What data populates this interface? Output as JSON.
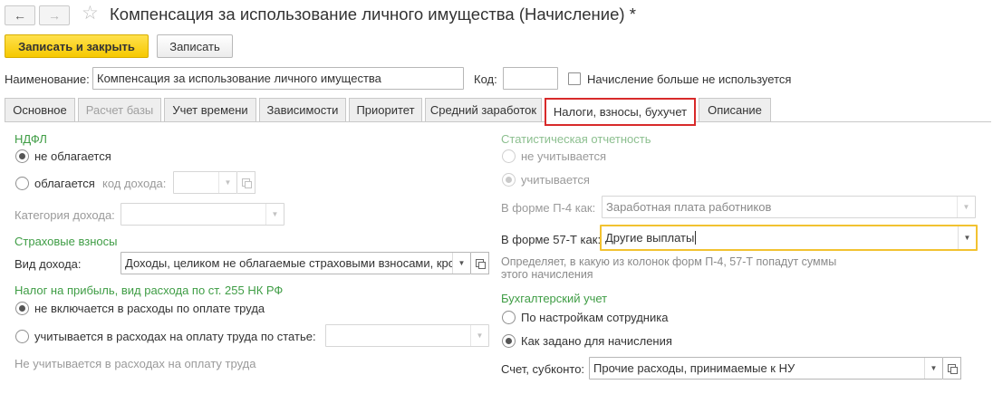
{
  "window": {
    "title": "Компенсация за использование личного имущества (Начисление) *"
  },
  "toolbar": {
    "save_close_label": "Записать и закрыть",
    "save_label": "Записать"
  },
  "header": {
    "name_label": "Наименование:",
    "name_value": "Компенсация за использование личного имущества",
    "code_label": "Код:",
    "code_value": "",
    "unused_label": "Начисление больше не используется"
  },
  "tabs": [
    {
      "label": "Основное"
    },
    {
      "label": "Расчет базы"
    },
    {
      "label": "Учет времени"
    },
    {
      "label": "Зависимости"
    },
    {
      "label": "Приоритет"
    },
    {
      "label": "Средний заработок"
    },
    {
      "label": "Налоги, взносы, бухучет"
    },
    {
      "label": "Описание"
    }
  ],
  "ndfl": {
    "section": "НДФЛ",
    "not_taxed": "не облагается",
    "taxed": "облагается",
    "income_code_label": "код дохода:",
    "income_code_value": "",
    "category_label": "Категория дохода:",
    "category_value": ""
  },
  "insurance": {
    "section": "Страховые взносы",
    "income_type_label": "Вид дохода:",
    "income_type_value": "Доходы, целиком не облагаемые страховыми взносами, кро"
  },
  "profit_tax": {
    "section": "Налог на прибыль, вид расхода по ст. 255 НК РФ",
    "not_included": "не включается в расходы по оплате труда",
    "included": "учитывается в расходах на оплату труда по статье:",
    "article_value": "",
    "note": "Не учитывается в расходах на оплату труда"
  },
  "statistics": {
    "section": "Статистическая отчетность",
    "not_counted": "не учитывается",
    "counted": "учитывается",
    "p4_label": "В форме П-4 как:",
    "p4_value": "Заработная плата работников",
    "f57t_label": "В форме 57-Т как:",
    "f57t_value": "Другие выплаты",
    "hint_line1": "Определяет, в какую из колонок форм П-4, 57-Т попадут суммы",
    "hint_line2": "этого начисления"
  },
  "accounting": {
    "section": "Бухгалтерский учет",
    "by_employee": "По настройкам сотрудника",
    "as_set": "Как задано для начисления",
    "account_label": "Счет, субконто:",
    "account_value": "Прочие расходы, принимаемые к НУ"
  },
  "colors": {
    "accent_yellow": "#f6c900",
    "section_green": "#3f9d45",
    "active_tab_border": "#d82a2a",
    "focus_border": "#f2c230"
  }
}
